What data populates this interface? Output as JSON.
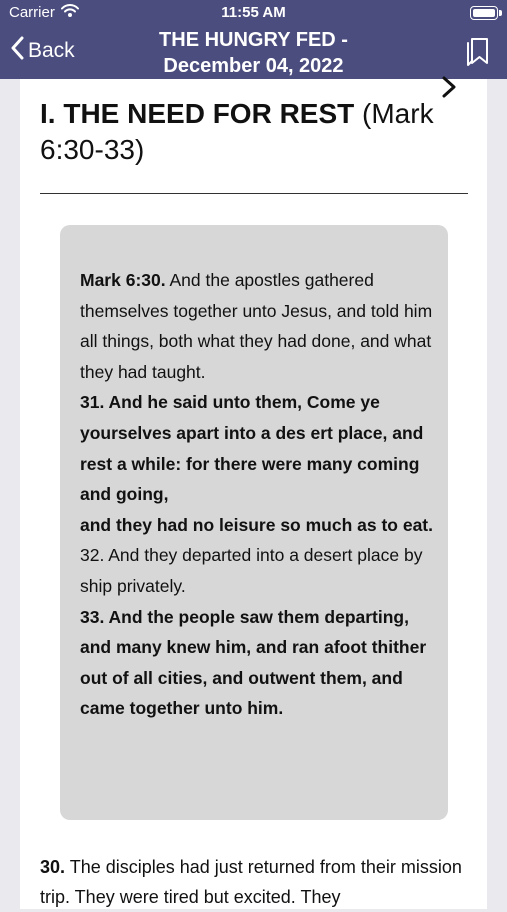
{
  "status_bar": {
    "carrier": "Carrier",
    "time": "11:55 AM"
  },
  "nav": {
    "back_label": "Back",
    "title_line1": "THE HUNGRY FED -",
    "title_line2": "December 04, 2022"
  },
  "section": {
    "heading_bold": "I. THE NEED FOR REST",
    "heading_ref": " (Mark 6:30-33)"
  },
  "scripture": {
    "v30_ref": "Mark 6:30.",
    "v30_text": " And the apostles gathered themselves together unto Jesus, and told him all things, both what they had done, and what they had taught.",
    "v31a": "31. And he said unto them, Come ye yourselves apart into a des ert place, and rest a while: for there were many coming and going,",
    "v31b": "and they had no leisure so much as to eat.",
    "v32": "32. And they departed into a desert place by ship privately.",
    "v33": "33. And the people saw them departing, and many knew him, and ran afoot thither out of all cities, and outwent them, and came together unto him."
  },
  "commentary": {
    "number": "30.",
    "text": " The disciples had just returned from their mission trip. They were tired but excited. They"
  }
}
